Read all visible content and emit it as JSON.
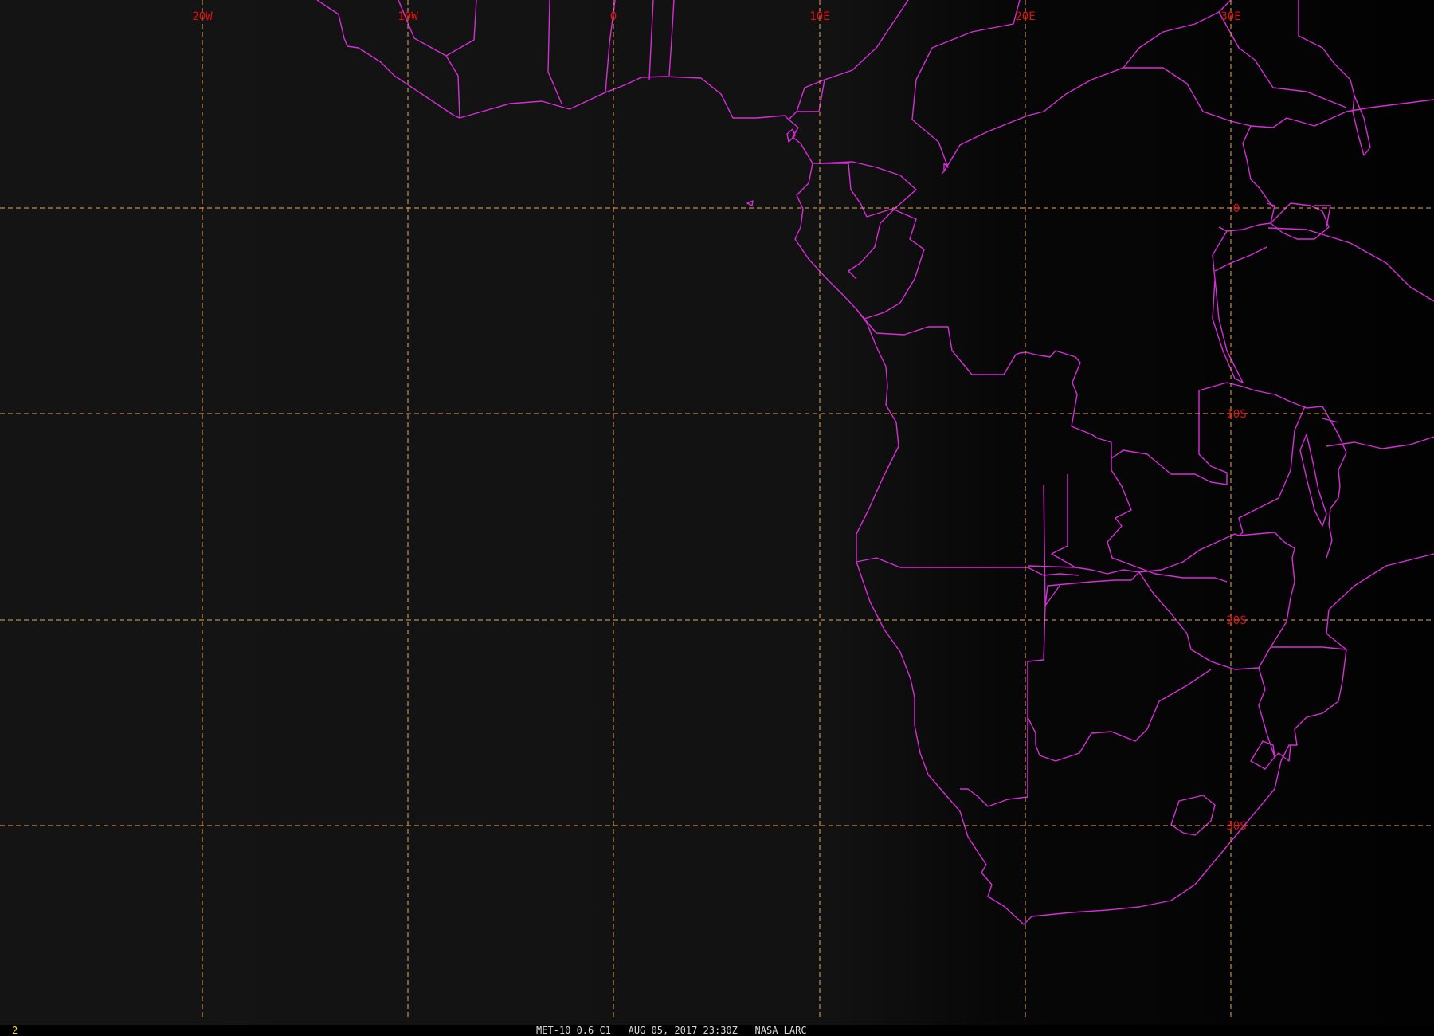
{
  "colors": {
    "grid": "#e8a85a",
    "boundary": "#d62ed6",
    "label": "#e01010",
    "frame_number": "#ffd700",
    "caption": "#d8d8d8",
    "background_left": "#141414",
    "background_right": "#020202"
  },
  "grid": {
    "lon_labels": [
      "20W",
      "10W",
      "0",
      "10E",
      "20E",
      "30E"
    ],
    "lat_labels": [
      "0",
      "10S",
      "20S",
      "30S"
    ]
  },
  "status": {
    "frame_number": "2",
    "caption": "MET-10 0.6 C1   AUG 05, 2017 23:30Z   NASA LARC"
  }
}
